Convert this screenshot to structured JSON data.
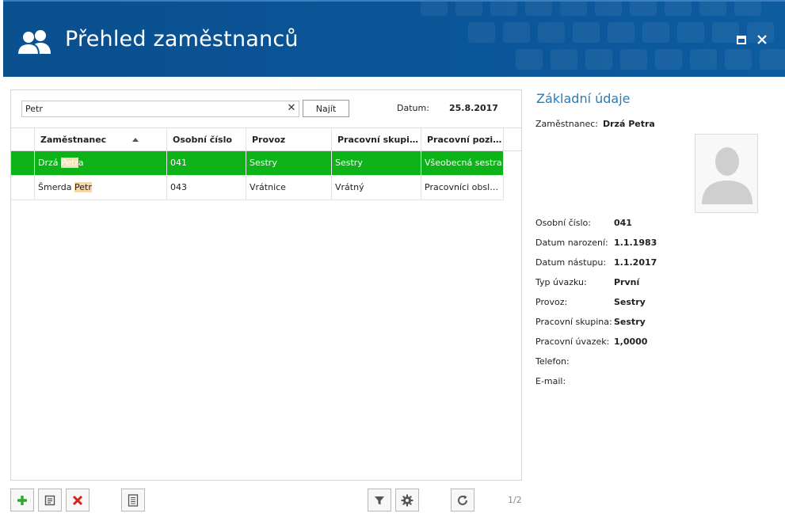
{
  "window": {
    "title": "Přehled zaměstnanců"
  },
  "search": {
    "value": "Petr",
    "find_label": "Najít",
    "date_label": "Datum:",
    "date_value": "25.8.2017"
  },
  "grid": {
    "columns": [
      "Zaměstnanec",
      "Osobní číslo",
      "Provoz",
      "Pracovní skupina",
      "Pracovní pozice"
    ],
    "rows": [
      {
        "employee_pre": "Drzá ",
        "employee_match": "Petr",
        "employee_post": "a",
        "number": "041",
        "operation": "Sestry",
        "group": "Sestry",
        "position": "Všeobecná sestra",
        "selected": true
      },
      {
        "employee_pre": "Šmerda ",
        "employee_match": "Petr",
        "employee_post": "",
        "number": "043",
        "operation": "Vrátnice",
        "group": "Vrátný",
        "position": "Pracovníci obsluž…",
        "selected": false
      }
    ]
  },
  "pager": "1/2",
  "details": {
    "title": "Základní údaje",
    "employee_label": "Zaměstnanec:",
    "employee_value": "Drzá Petra",
    "fields": [
      {
        "label": "Osobní číslo:",
        "value": "041"
      },
      {
        "label": "Datum narození:",
        "value": "1.1.1983"
      },
      {
        "label": "Datum nástupu:",
        "value": "1.1.2017"
      },
      {
        "label": "Typ úvazku:",
        "value": "První"
      },
      {
        "label": "Provoz:",
        "value": "Sestry"
      },
      {
        "label": "Pracovní skupina:",
        "value": "Sestry"
      },
      {
        "label": "Pracovní úvazek:",
        "value": "1,0000"
      },
      {
        "label": "Telefon:",
        "value": ""
      },
      {
        "label": "E-mail:",
        "value": ""
      }
    ]
  },
  "colors": {
    "header": "#0b5597",
    "selected_row": "#0db318",
    "accent_title": "#1e7fc4",
    "highlight": "#f7d7a8",
    "add_icon": "#2fa82f",
    "delete_icon": "#d9221c"
  },
  "icons": {
    "header": "users-icon",
    "toolbar": [
      "add-icon",
      "edit-icon",
      "delete-icon",
      "report-icon",
      "filter-icon",
      "settings-icon",
      "refresh-icon"
    ]
  }
}
